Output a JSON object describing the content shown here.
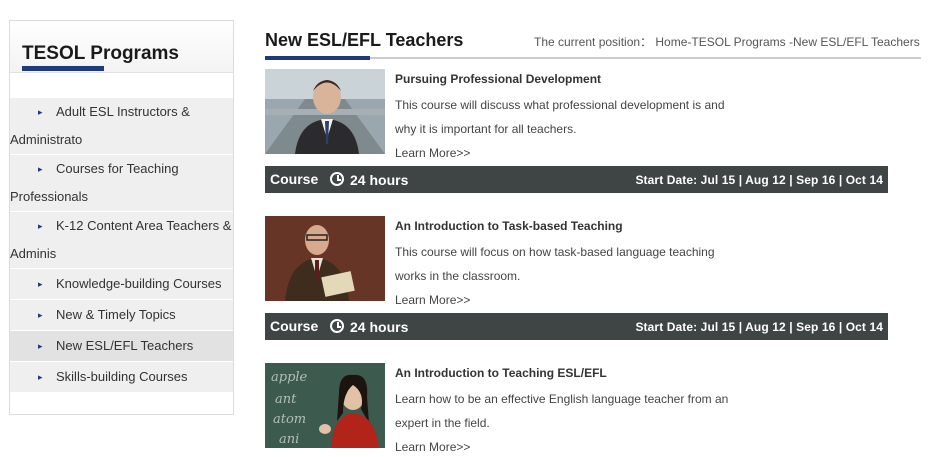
{
  "sidebar": {
    "title": "TESOL Programs",
    "items": [
      {
        "line1": "Adult ESL Instructors &",
        "line2": "Administrato"
      },
      {
        "line1": "Courses for Teaching",
        "line2": "Professionals"
      },
      {
        "line1": "K-12 Content Area Teachers &",
        "line2": "Adminis"
      },
      {
        "line1": "Knowledge-building Courses"
      },
      {
        "line1": "New & Timely Topics"
      },
      {
        "line1": "New ESL/EFL Teachers"
      },
      {
        "line1": "Skills-building Courses"
      }
    ]
  },
  "main": {
    "title": "New ESL/EFL Teachers",
    "breadcrumb": "The current position： Home-TESOL Programs -New ESL/EFL Teachers"
  },
  "courses": [
    {
      "title": "Pursuing Professional Development",
      "desc_line1": "This course will discuss what professional development is and",
      "desc_line2": "why it is important for all teachers.",
      "more": "Learn More>>",
      "bar_label": "Course",
      "hours": "24 hours",
      "start": "Start Date: Jul 15 | Aug 12 | Sep 16 | Oct 14"
    },
    {
      "title": "An Introduction to Task-based Teaching",
      "desc_line1": "This course will focus on how task-based language teaching",
      "desc_line2": "works in the classroom.",
      "more": "Learn More>>",
      "bar_label": "Course",
      "hours": "24 hours",
      "start": "Start Date: Jul 15 | Aug 12 | Sep 16 | Oct 14"
    },
    {
      "title": "An Introduction to Teaching ESL/EFL",
      "desc_line1": "Learn how to be an effective English language teacher from an",
      "desc_line2": "expert in the field.",
      "more": "Learn More>>",
      "chalk_words": [
        "apple",
        "ant",
        "atom",
        "ani"
      ]
    }
  ]
}
